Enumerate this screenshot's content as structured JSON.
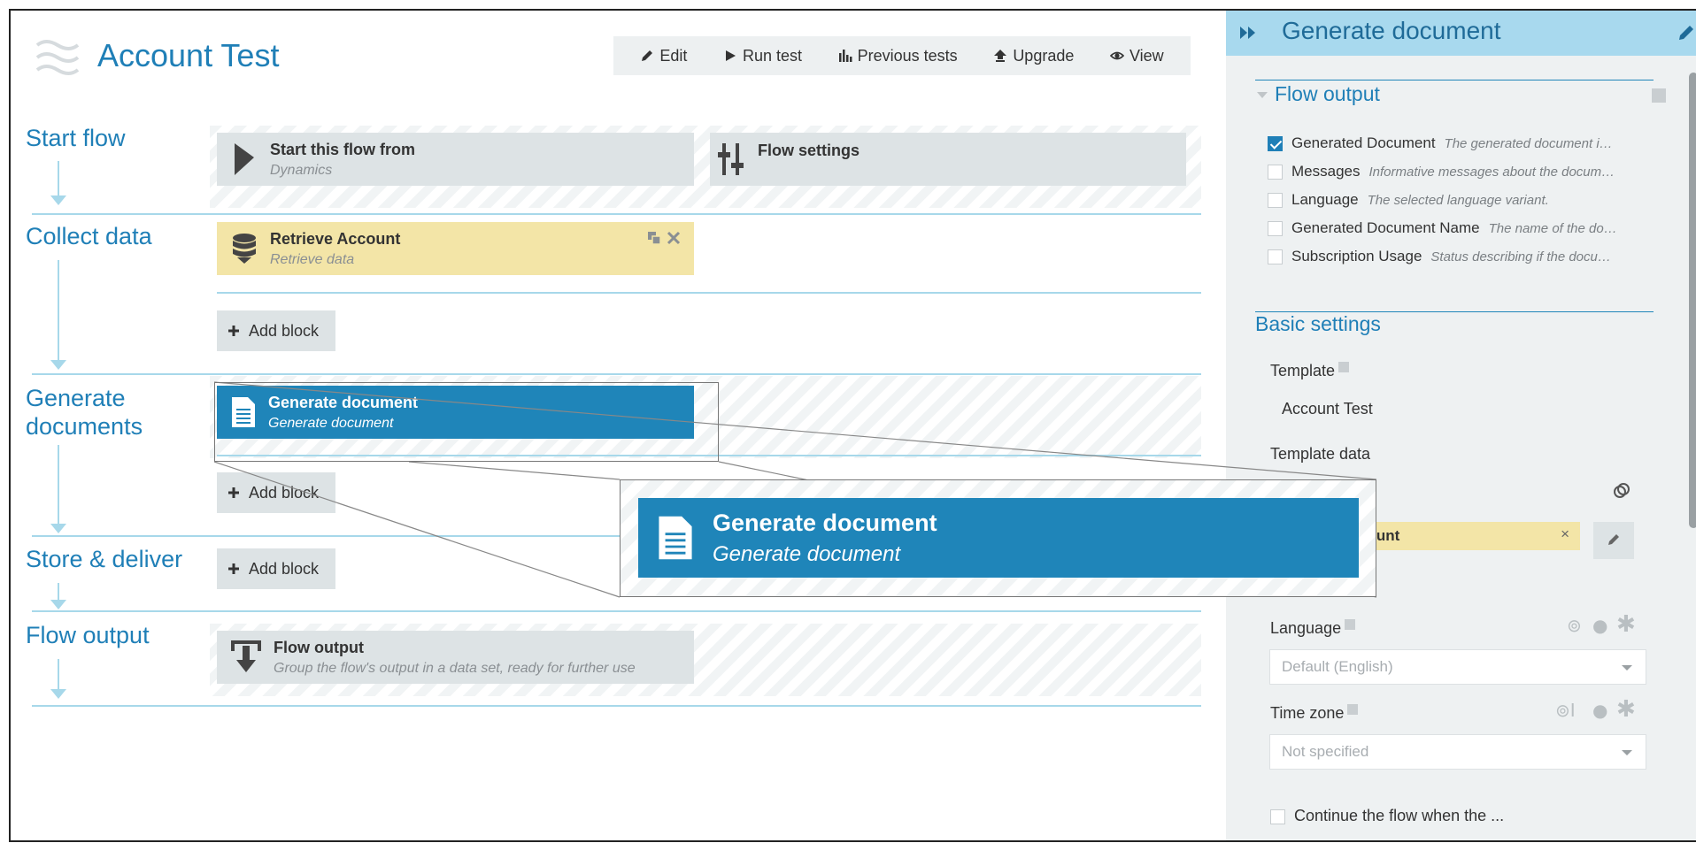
{
  "header": {
    "title": "Account Test",
    "toolbar": [
      {
        "label": "Edit",
        "icon": "pencil-icon"
      },
      {
        "label": "Run test",
        "icon": "play-icon"
      },
      {
        "label": "Previous tests",
        "icon": "bar-chart-icon"
      },
      {
        "label": "Upgrade",
        "icon": "upload-arrow-icon"
      },
      {
        "label": "View",
        "icon": "eye-icon"
      }
    ]
  },
  "sections": {
    "start": {
      "title": "Start flow",
      "start_block": {
        "title": "Start this flow from",
        "subtitle": "Dynamics"
      },
      "settings_block": {
        "title": "Flow settings"
      }
    },
    "collect": {
      "title": "Collect data",
      "block": {
        "title": "Retrieve Account",
        "subtitle": "Retrieve data"
      },
      "add_label": "Add block"
    },
    "generate": {
      "title_line1": "Generate",
      "title_line2": "documents",
      "block": {
        "title": "Generate document",
        "subtitle": "Generate document"
      },
      "add_label": "Add block"
    },
    "store": {
      "title": "Store & deliver",
      "add_label": "Add block"
    },
    "output": {
      "title": "Flow output",
      "block": {
        "title": "Flow output",
        "subtitle": "Group the flow's output in a data set, ready for further use"
      }
    }
  },
  "zoom": {
    "title": "Generate document",
    "subtitle": "Generate document"
  },
  "panel": {
    "title": "Generate document",
    "flow_output": {
      "title": "Flow output",
      "items": [
        {
          "name": "Generated Document",
          "desc": "The generated document i…",
          "checked": true
        },
        {
          "name": "Messages",
          "desc": "Informative messages about the docum…",
          "checked": false
        },
        {
          "name": "Language",
          "desc": "The selected language variant.",
          "checked": false
        },
        {
          "name": "Generated Document Name",
          "desc": "The name of the do…",
          "checked": false
        },
        {
          "name": "Subscription Usage",
          "desc": "Status describing if the docu…",
          "checked": false
        }
      ]
    },
    "basic_settings": {
      "title": "Basic settings",
      "template_label": "Template",
      "template_value": "Account Test",
      "template_data_label": "Template data",
      "template_data_partial": "t",
      "chip_value": "count",
      "language_label": "Language",
      "language_value": "Default (English)",
      "timezone_label": "Time zone",
      "timezone_value": "Not specified",
      "truncated_option": "Continue the flow when the ..."
    }
  },
  "colors": {
    "accent": "#1f7fb7",
    "block_blue": "#1f85b9",
    "block_yellow": "#f3e5a7",
    "block_gray": "#dde3e5",
    "panel_header": "#a8d9ee"
  }
}
